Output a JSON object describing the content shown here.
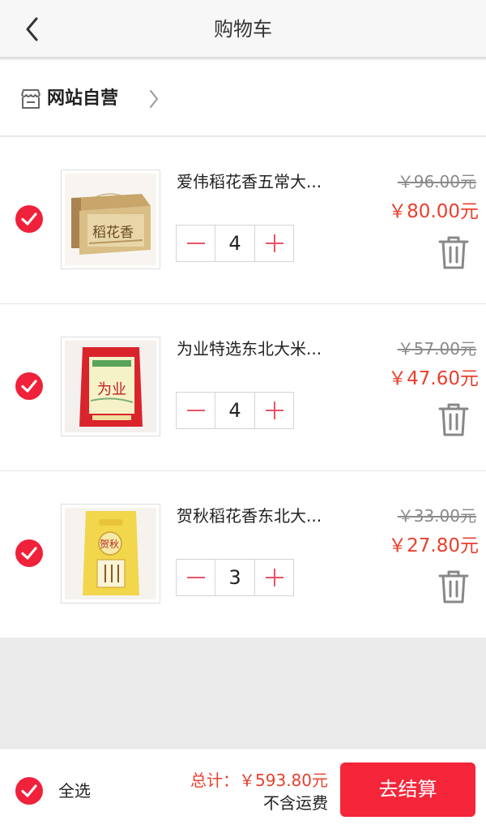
{
  "header": {
    "title": "购物车",
    "back_icon": "chevron-left-icon"
  },
  "store": {
    "name": "网站自营",
    "icon": "store-icon",
    "chevron_icon": "chevron-right-icon"
  },
  "items": [
    {
      "name": "爱伟稻花香五常大...",
      "quantity": "4",
      "original_price": "￥96.00元",
      "sale_price": "￥80.00元",
      "checked": true,
      "image_caption": "稻花香"
    },
    {
      "name": "为业特选东北大米...",
      "quantity": "4",
      "original_price": "￥57.00元",
      "sale_price": "￥47.60元",
      "checked": true,
      "image_caption": "为业"
    },
    {
      "name": "贺秋稻花香东北大...",
      "quantity": "3",
      "original_price": "￥33.00元",
      "sale_price": "￥27.80元",
      "checked": true,
      "image_caption": "贺秋"
    }
  ],
  "footer": {
    "select_all_label": "全选",
    "total": "总计：￥593.80元",
    "shipping_note": "不含运费",
    "checkout_label": "去结算"
  },
  "colors": {
    "accent": "#e8402f",
    "checkout": "#f5253a",
    "check": "#f0213a"
  }
}
